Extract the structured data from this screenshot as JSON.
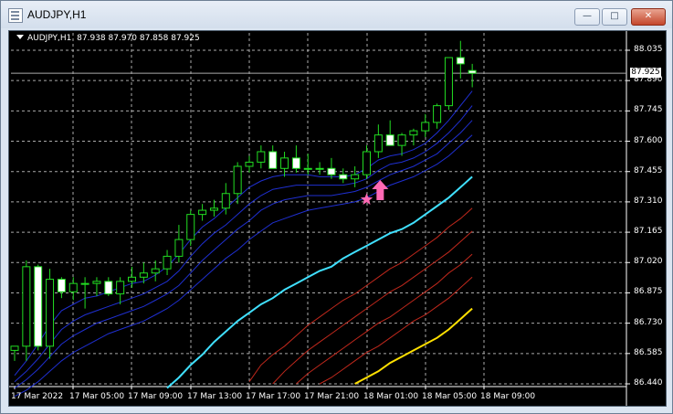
{
  "window": {
    "title": "AUDJPY,H1",
    "buttons": {
      "min": "—",
      "max": "□",
      "close": "✕"
    }
  },
  "header": {
    "symbol": "AUDJPY,H1",
    "ohlc": "87.938 87.970 87.858 87.925"
  },
  "y_ticks": [
    "88.035",
    "87.890",
    "87.745",
    "87.600",
    "87.455",
    "87.310",
    "87.165",
    "87.020",
    "86.875",
    "86.730",
    "86.585",
    "86.440"
  ],
  "current_price": "87.925",
  "x_ticks": [
    "17 Mar 2022",
    "17 Mar 05:00",
    "17 Mar 09:00",
    "17 Mar 13:00",
    "17 Mar 17:00",
    "17 Mar 21:00",
    "18 Mar 01:00",
    "18 Mar 05:00",
    "18 Mar 09:00"
  ],
  "colors": {
    "background": "#000000",
    "grid": "#c8c8c8",
    "bull": "#22dd22",
    "bear_body": "#ffffff",
    "ma_blue": "#1f2fd0",
    "ma_cyan": "#40e0ff",
    "ma_red": "#c0281c",
    "ma_yellow": "#ffe000",
    "marker": "#ff69b4"
  },
  "chart_data": {
    "type": "candlestick",
    "symbol": "AUDJPY",
    "timeframe": "H1",
    "ylim": [
      86.44,
      88.08
    ],
    "candles": [
      [
        86.6,
        86.62,
        86.55,
        86.62
      ],
      [
        86.62,
        87.03,
        86.55,
        87.0
      ],
      [
        87.0,
        87.01,
        86.6,
        86.62
      ],
      [
        86.62,
        86.99,
        86.56,
        86.94
      ],
      [
        86.94,
        86.95,
        86.85,
        86.88
      ],
      [
        86.88,
        86.95,
        86.84,
        86.92
      ],
      [
        86.92,
        86.95,
        86.8,
        86.92
      ],
      [
        86.92,
        86.95,
        86.86,
        86.93
      ],
      [
        86.93,
        86.95,
        86.86,
        86.87
      ],
      [
        86.87,
        86.95,
        86.82,
        86.93
      ],
      [
        86.93,
        87.0,
        86.9,
        86.95
      ],
      [
        86.95,
        87.02,
        86.92,
        86.97
      ],
      [
        86.97,
        87.03,
        86.93,
        86.99
      ],
      [
        86.99,
        87.08,
        86.96,
        87.05
      ],
      [
        87.05,
        87.2,
        87.02,
        87.13
      ],
      [
        87.13,
        87.27,
        87.1,
        87.25
      ],
      [
        87.25,
        87.3,
        87.22,
        87.27
      ],
      [
        87.27,
        87.32,
        87.24,
        87.28
      ],
      [
        87.28,
        87.4,
        87.25,
        87.35
      ],
      [
        87.35,
        87.5,
        87.3,
        87.48
      ],
      [
        87.48,
        87.53,
        87.45,
        87.5
      ],
      [
        87.5,
        87.58,
        87.47,
        87.55
      ],
      [
        87.55,
        87.58,
        87.47,
        87.47
      ],
      [
        87.47,
        87.55,
        87.43,
        87.52
      ],
      [
        87.52,
        87.58,
        87.45,
        87.47
      ],
      [
        87.47,
        87.54,
        87.44,
        87.47
      ],
      [
        87.47,
        87.5,
        87.44,
        87.47
      ],
      [
        87.47,
        87.52,
        87.42,
        87.44
      ],
      [
        87.44,
        87.47,
        87.4,
        87.42
      ],
      [
        87.42,
        87.48,
        87.38,
        87.44
      ],
      [
        87.44,
        87.58,
        87.42,
        87.55
      ],
      [
        87.55,
        87.68,
        87.52,
        87.63
      ],
      [
        87.63,
        87.7,
        87.58,
        87.58
      ],
      [
        87.58,
        87.64,
        87.53,
        87.63
      ],
      [
        87.63,
        87.66,
        87.58,
        87.65
      ],
      [
        87.65,
        87.73,
        87.62,
        87.69
      ],
      [
        87.69,
        87.78,
        87.66,
        87.77
      ],
      [
        87.77,
        87.97,
        87.75,
        88.0
      ],
      [
        88.0,
        88.08,
        87.9,
        87.97
      ],
      [
        87.938,
        87.97,
        87.858,
        87.925
      ]
    ],
    "moving_averages": [
      {
        "color": "#1f2fd0",
        "values": [
          86.48,
          86.55,
          86.63,
          86.72,
          86.79,
          86.82,
          86.85,
          86.86,
          86.88,
          86.9,
          86.92,
          86.93,
          86.96,
          87.0,
          87.06,
          87.13,
          87.19,
          87.23,
          87.28,
          87.33,
          87.38,
          87.41,
          87.43,
          87.44,
          87.44,
          87.44,
          87.43,
          87.43,
          87.43,
          87.44,
          87.47,
          87.51,
          87.53,
          87.54,
          87.56,
          87.59,
          87.64,
          87.7,
          87.77,
          87.84
        ]
      },
      {
        "color": "#1f2fd0",
        "values": [
          86.45,
          86.5,
          86.56,
          86.63,
          86.7,
          86.74,
          86.77,
          86.79,
          86.81,
          86.83,
          86.85,
          86.87,
          86.9,
          86.93,
          86.98,
          87.05,
          87.11,
          87.16,
          87.2,
          87.25,
          87.3,
          87.34,
          87.37,
          87.38,
          87.39,
          87.39,
          87.39,
          87.39,
          87.39,
          87.4,
          87.42,
          87.46,
          87.49,
          87.5,
          87.52,
          87.55,
          87.59,
          87.64,
          87.7,
          87.77
        ]
      },
      {
        "color": "#1f2fd0",
        "values": [
          86.42,
          86.46,
          86.51,
          86.57,
          86.63,
          86.67,
          86.7,
          86.73,
          86.75,
          86.77,
          86.79,
          86.81,
          86.84,
          86.87,
          86.91,
          86.97,
          87.03,
          87.08,
          87.13,
          87.18,
          87.22,
          87.27,
          87.3,
          87.32,
          87.33,
          87.34,
          87.34,
          87.34,
          87.35,
          87.36,
          87.38,
          87.41,
          87.44,
          87.46,
          87.48,
          87.51,
          87.54,
          87.59,
          87.64,
          87.7
        ]
      },
      {
        "color": "#1f2fd0",
        "values": [
          86.38,
          86.41,
          86.45,
          86.5,
          86.55,
          86.59,
          86.62,
          86.65,
          86.68,
          86.7,
          86.72,
          86.74,
          86.77,
          86.8,
          86.84,
          86.89,
          86.94,
          86.99,
          87.04,
          87.08,
          87.13,
          87.17,
          87.21,
          87.23,
          87.25,
          87.27,
          87.28,
          87.29,
          87.3,
          87.31,
          87.33,
          87.36,
          87.39,
          87.41,
          87.43,
          87.46,
          87.49,
          87.53,
          87.58,
          87.63
        ]
      },
      {
        "color": "#40e0ff",
        "values": [
          null,
          null,
          null,
          null,
          null,
          null,
          null,
          null,
          null,
          null,
          null,
          null,
          null,
          86.42,
          86.47,
          86.53,
          86.58,
          86.64,
          86.69,
          86.74,
          86.78,
          86.82,
          86.85,
          86.89,
          86.92,
          86.95,
          86.98,
          87.0,
          87.04,
          87.07,
          87.1,
          87.13,
          87.16,
          87.18,
          87.21,
          87.25,
          87.29,
          87.33,
          87.38,
          87.43
        ]
      },
      {
        "color": "#c0281c",
        "values": [
          null,
          null,
          null,
          null,
          null,
          null,
          null,
          null,
          null,
          null,
          null,
          null,
          null,
          null,
          null,
          null,
          null,
          null,
          null,
          null,
          86.45,
          86.53,
          86.58,
          86.62,
          86.67,
          86.72,
          86.76,
          86.8,
          86.84,
          86.87,
          86.91,
          86.95,
          86.99,
          87.02,
          87.06,
          87.1,
          87.14,
          87.19,
          87.23,
          87.28
        ]
      },
      {
        "color": "#c0281c",
        "values": [
          null,
          null,
          null,
          null,
          null,
          null,
          null,
          null,
          null,
          null,
          null,
          null,
          null,
          null,
          null,
          null,
          null,
          null,
          null,
          null,
          null,
          null,
          86.44,
          86.5,
          86.55,
          86.6,
          86.64,
          86.68,
          86.72,
          86.76,
          86.8,
          86.84,
          86.88,
          86.91,
          86.95,
          86.99,
          87.03,
          87.07,
          87.12,
          87.17
        ]
      },
      {
        "color": "#c0281c",
        "values": [
          null,
          null,
          null,
          null,
          null,
          null,
          null,
          null,
          null,
          null,
          null,
          null,
          null,
          null,
          null,
          null,
          null,
          null,
          null,
          null,
          null,
          null,
          null,
          null,
          86.44,
          86.49,
          86.53,
          86.57,
          86.61,
          86.65,
          86.69,
          86.73,
          86.76,
          86.8,
          86.84,
          86.88,
          86.92,
          86.97,
          87.01,
          87.06
        ]
      },
      {
        "color": "#c0281c",
        "values": [
          null,
          null,
          null,
          null,
          null,
          null,
          null,
          null,
          null,
          null,
          null,
          null,
          null,
          null,
          null,
          null,
          null,
          null,
          null,
          null,
          null,
          null,
          null,
          null,
          null,
          null,
          86.44,
          86.47,
          86.51,
          86.55,
          86.59,
          86.62,
          86.66,
          86.7,
          86.74,
          86.77,
          86.81,
          86.85,
          86.9,
          86.95
        ]
      },
      {
        "color": "#ffe000",
        "values": [
          null,
          null,
          null,
          null,
          null,
          null,
          null,
          null,
          null,
          null,
          null,
          null,
          null,
          null,
          null,
          null,
          null,
          null,
          null,
          null,
          null,
          null,
          null,
          null,
          null,
          null,
          null,
          null,
          null,
          86.44,
          86.47,
          86.5,
          86.54,
          86.57,
          86.6,
          86.63,
          86.66,
          86.7,
          86.75,
          86.8
        ]
      }
    ],
    "markers": [
      {
        "type": "star",
        "index": 30,
        "price": 87.33
      },
      {
        "type": "up-arrow",
        "index": 31,
        "price": 87.34
      }
    ]
  }
}
